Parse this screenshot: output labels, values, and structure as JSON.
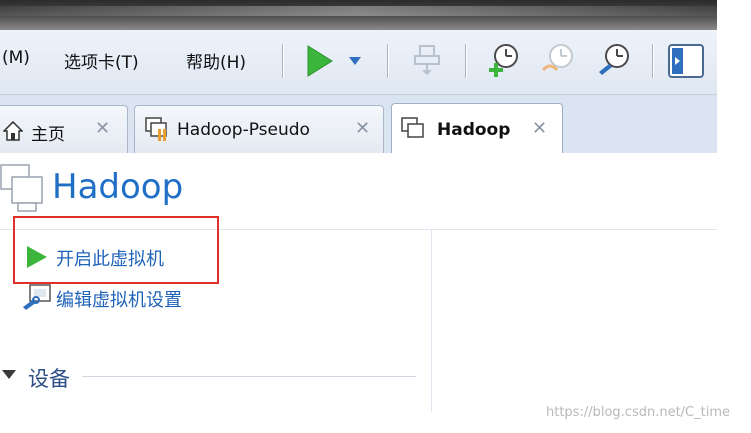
{
  "menu": {
    "view_label": "(M)",
    "tabs_label": "选项卡(T)",
    "help_label": "帮助(H)"
  },
  "tabs": [
    {
      "label": "主页",
      "close": "✕",
      "icon": "home-icon"
    },
    {
      "label": "Hadoop-Pseudo",
      "close": "✕",
      "icon": "vm-icon"
    },
    {
      "label": "Hadoop",
      "close": "✕",
      "icon": "vm-icon",
      "active": true
    }
  ],
  "vm": {
    "title": "Hadoop",
    "power_on_label": "开启此虚拟机",
    "edit_settings_label": "编辑虚拟机设置",
    "devices_label": "设备"
  },
  "watermark": "https://blog.csdn.net/C_time",
  "colors": {
    "accent": "#1f6fc7",
    "play_green": "#3cb53c",
    "highlight_red": "#e0302a"
  }
}
